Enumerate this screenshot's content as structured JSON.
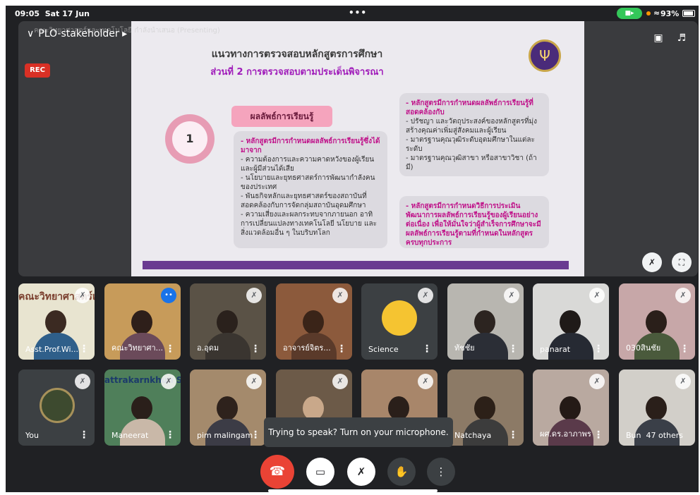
{
  "status_bar": {
    "time": "09:05",
    "date": "Sat 17 Jun",
    "dots": "•••",
    "battery": "93%"
  },
  "stage": {
    "title": "PLO-stakeholder",
    "caption": "คณะวิทยาศาสตร์และเทคโนโลยี กำลังนำเสนอ (Presenting)",
    "rec_label": "REC"
  },
  "slide": {
    "title": "แนวทางการตรวจสอบหลักสูตรการศึกษา",
    "subtitle": "ส่วนที่ 2 การตรวจสอบตามประเด็นพิจารณา",
    "number": "1",
    "pill": "ผลลัพธ์การเรียนรู้",
    "left_head": "- หลักสูตรมีการกำหนดผลลัพธ์การเรียนรู้ซึ่งได้มาจาก",
    "left_items": [
      "- ความต้องการและความคาดหวังของผู้เรียนและผู้มีส่วนได้เสีย",
      "- นโยบายและยุทธศาสตร์การพัฒนากำลังคนของประเทศ",
      "- พันธกิจหลักและยุทธศาสตร์ของสถาบันที่สอดคล้องกับการจัดกลุ่มสถาบันอุดมศึกษา",
      "- ความเสี่ยงและผลกระทบจากภายนอก อาทิ การเปลี่ยนแปลงทางเทคโนโลยี นโยบาย และสิ่งแวดล้อมอื่น ๆ ในบริบทโลก"
    ],
    "right1_head": "- หลักสูตรมีการกำหนดผลลัพธ์การเรียนรู้ที่สอดคล้องกับ",
    "right1_items": [
      "- ปรัชญา และวัตถุประสงค์ของหลักสูตรที่มุ่งสร้างคุณค่าเพิ่มสู่สังคมและผู้เรียน",
      "- มาตรฐานคุณวุฒิระดับอุดมศึกษาในแต่ละระดับ",
      "- มาตรฐานคุณวุฒิสาขา หรือสาขาวิชา (ถ้ามี)"
    ],
    "right2": "- หลักสูตรมีการกำหนดวิธีการประเมินพัฒนาการผลลัพธ์การเรียนรู้ของผู้เรียนอย่างต่อเนื่อง เพื่อให้มั่นใจว่าผู้สำเร็จการศึกษาจะมีผลลัพธ์การเรียนรู้ตามที่กำหนดในหลักสูตรครบทุกประการ"
  },
  "participants": [
    {
      "name": "Asst.Prof.Wi...",
      "muted": true,
      "speaking": false
    },
    {
      "name": "คณะวิทยาศา...",
      "muted": false,
      "speaking": true
    },
    {
      "name": "อ.อุดม",
      "muted": true,
      "speaking": false
    },
    {
      "name": "อาจารย์จิตร...",
      "muted": true,
      "speaking": false
    },
    {
      "name": "Science",
      "muted": true,
      "speaking": false
    },
    {
      "name": "ทัชชัย",
      "muted": true,
      "speaking": false
    },
    {
      "name": "panarat",
      "muted": true,
      "speaking": false
    },
    {
      "name": "030สินชัย",
      "muted": true,
      "speaking": false
    },
    {
      "name": "You",
      "muted": true,
      "speaking": false
    },
    {
      "name": "Maneerat",
      "muted": true,
      "speaking": false
    },
    {
      "name": "pim malingam",
      "muted": true,
      "speaking": false
    },
    {
      "name": "",
      "muted": true,
      "speaking": false
    },
    {
      "name": "",
      "muted": true,
      "speaking": false
    },
    {
      "name": "Natchaya",
      "muted": true,
      "speaking": false
    },
    {
      "name": "ผศ.ดร.อาภาพร",
      "muted": true,
      "speaking": false
    },
    {
      "name": "Bun",
      "muted": true,
      "speaking": false
    }
  ],
  "tile_banner": "คณะวิทยาศาสตร์และเทค",
  "tile_banner2": "attrakarnkhun Sc",
  "others_count": "47 others",
  "toast": "Trying to speak? Turn on your microphone.",
  "icons": {
    "camera_off": "camera-off-icon",
    "mic_off": "mic-off-icon",
    "hand": "hand-raise-icon",
    "more": "more-vert-icon",
    "end": "end-call-icon"
  },
  "colors": {
    "accent": "#1a73e8",
    "end_call": "#ea4335",
    "rec": "#d93025",
    "slide_magenta": "#c0138a"
  }
}
